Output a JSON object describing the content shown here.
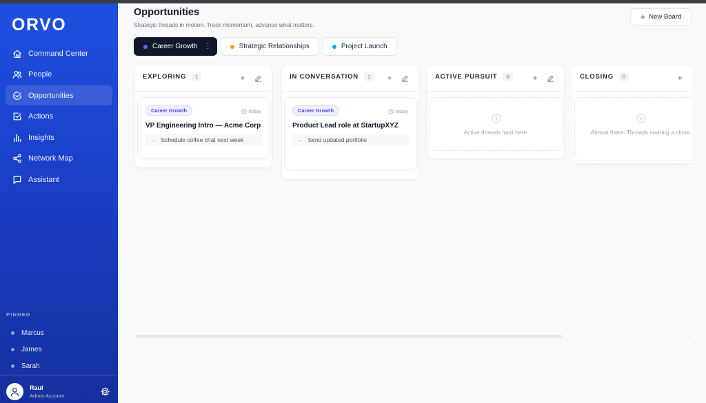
{
  "app": {
    "logo": "ORVO"
  },
  "sidebar": {
    "nav": [
      {
        "label": "Command Center",
        "icon": "home-icon",
        "active": false
      },
      {
        "label": "People",
        "icon": "users-icon",
        "active": false
      },
      {
        "label": "Opportunities",
        "icon": "check-circle-icon",
        "active": true
      },
      {
        "label": "Actions",
        "icon": "check-square-icon",
        "active": false
      },
      {
        "label": "Insights",
        "icon": "bar-chart-icon",
        "active": false
      },
      {
        "label": "Network Map",
        "icon": "share-icon",
        "active": false
      },
      {
        "label": "Assistant",
        "icon": "chat-icon",
        "active": false
      }
    ],
    "pinned_label": "PINNED",
    "pinned": [
      "Marcus",
      "James",
      "Sarah"
    ],
    "user": {
      "name": "Raul",
      "role": "Admin Account"
    }
  },
  "page": {
    "title": "Opportunities",
    "subtitle": "Strategic threads in motion. Track momentum, advance what matters.",
    "new_board": "New Board"
  },
  "tabs": [
    {
      "label": "Career Growth",
      "color": "#6366f1",
      "active": true
    },
    {
      "label": "Strategic Relationships",
      "color": "#f59e0b",
      "active": false
    },
    {
      "label": "Project Launch",
      "color": "#06b6d4",
      "active": false
    }
  ],
  "columns": [
    {
      "title": "EXPLORING",
      "count": "1",
      "card": {
        "tag": "Career Growth",
        "time": "today",
        "title": "VP Engineering Intro — Acme Corp",
        "next": "Schedule coffee chat next week"
      }
    },
    {
      "title": "IN CONVERSATION",
      "count": "1",
      "card": {
        "tag": "Career Growth",
        "time": "today",
        "title": "Product Lead role at StartupXYZ",
        "next": "Send updated portfolio"
      }
    },
    {
      "title": "ACTIVE PURSUIT",
      "count": "0",
      "empty": "Active threads land here."
    },
    {
      "title": "CLOSING",
      "count": "0",
      "empty": "Almost there. Threads nearing a close."
    }
  ],
  "colors": {
    "sidebar_top": "#1f4fe0",
    "sidebar_bottom": "#15309d",
    "accent": "#4f46e5"
  }
}
